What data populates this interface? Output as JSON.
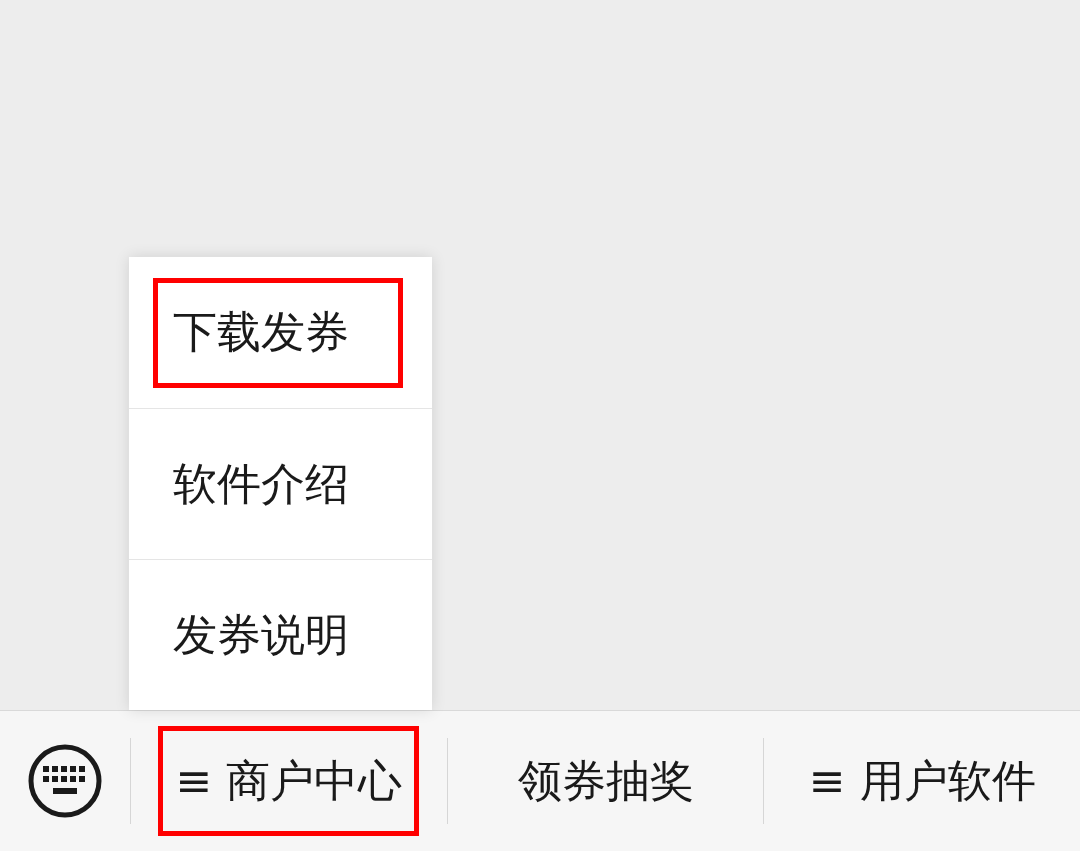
{
  "popup_menu": {
    "items": [
      {
        "label": "下载发券",
        "highlighted": true
      },
      {
        "label": "软件介绍",
        "highlighted": false
      },
      {
        "label": "发券说明",
        "highlighted": false
      }
    ]
  },
  "bottom_menu": {
    "items": [
      {
        "marker": "≡",
        "label": "商户中心",
        "highlighted": true
      },
      {
        "label": "领券抽奖",
        "highlighted": false
      },
      {
        "marker": "≡",
        "label": "用户软件",
        "highlighted": false
      }
    ]
  }
}
